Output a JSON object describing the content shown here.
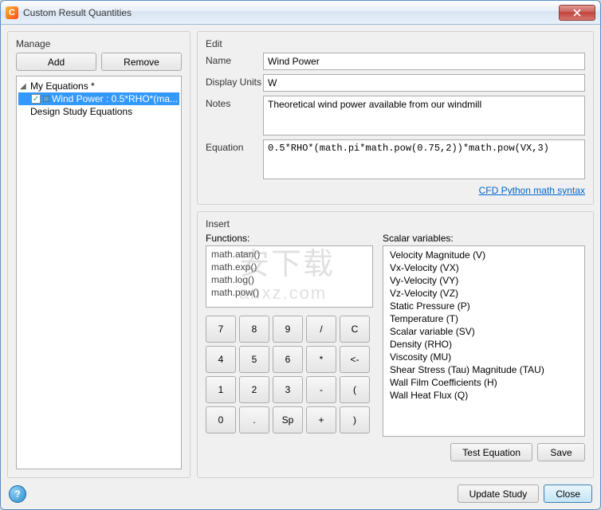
{
  "window": {
    "title": "Custom Result Quantities"
  },
  "manage": {
    "title": "Manage",
    "add_label": "Add",
    "remove_label": "Remove",
    "tree": {
      "root_label": "My Equations *",
      "item_label": "Wind Power : 0.5*RHO*(ma...",
      "design_label": "Design Study Equations"
    }
  },
  "edit": {
    "title": "Edit",
    "name_label": "Name",
    "name_value": "Wind Power",
    "units_label": "Display Units",
    "units_value": "W",
    "notes_label": "Notes",
    "notes_value": "Theoretical wind power available from our windmill",
    "equation_label": "Equation",
    "equation_value": "0.5*RHO*(math.pi*math.pow(0.75,2))*math.pow(VX,3)",
    "syntax_link": "CFD Python math syntax"
  },
  "insert": {
    "title": "Insert",
    "functions_label": "Functions:",
    "functions": [
      "math.atan()",
      "math.exp()",
      "math.log()",
      "math.pow()"
    ],
    "variables_label": "Scalar variables:",
    "variables": [
      "Velocity Magnitude (V)",
      "Vx-Velocity (VX)",
      "Vy-Velocity (VY)",
      "Vz-Velocity (VZ)",
      "Static Pressure (P)",
      "Temperature (T)",
      "Scalar variable (SV)",
      "Density (RHO)",
      "Viscosity (MU)",
      "Shear Stress (Tau) Magnitude (TAU)",
      "Wall Film Coefficients (H)",
      "Wall Heat Flux (Q)"
    ],
    "keypad": [
      "7",
      "8",
      "9",
      "/",
      "C",
      "4",
      "5",
      "6",
      "*",
      "<-",
      "1",
      "2",
      "3",
      "-",
      "(",
      "0",
      ".",
      "Sp",
      "+",
      ")"
    ]
  },
  "actions": {
    "test_label": "Test Equation",
    "save_label": "Save",
    "update_label": "Update Study",
    "close_label": "Close"
  },
  "watermark": {
    "line1": "安下载",
    "line2": "anxz.com"
  }
}
